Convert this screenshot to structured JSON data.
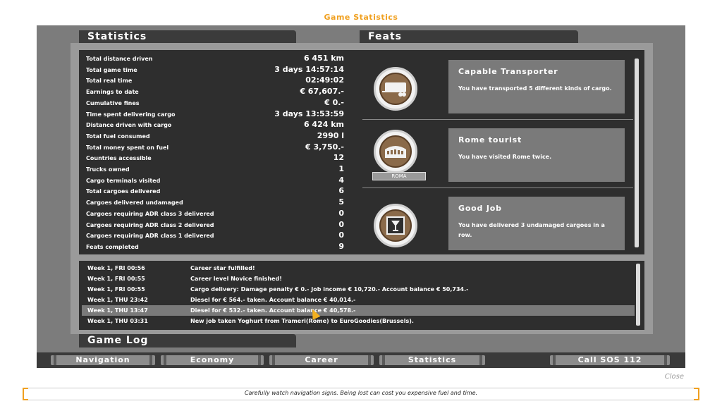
{
  "window_title": "Game Statistics",
  "tabs": {
    "statistics": "Statistics",
    "feats": "Feats",
    "game_log": "Game Log"
  },
  "stats": [
    {
      "label": "Total distance driven",
      "value": "6 451 km"
    },
    {
      "label": "Total game time",
      "value": "3 days 14:57:14"
    },
    {
      "label": "Total real time",
      "value": "02:49:02"
    },
    {
      "label": "Earnings to date",
      "value": "€ 67,607.-"
    },
    {
      "label": "Cumulative fines",
      "value": "€ 0.-"
    },
    {
      "label": "Time spent delivering cargo",
      "value": "3 days 13:53:59"
    },
    {
      "label": "Distance driven with cargo",
      "value": "6 424 km"
    },
    {
      "label": "Total fuel consumed",
      "value": "2990 l"
    },
    {
      "label": "Total money spent on fuel",
      "value": "€ 3,750.-"
    },
    {
      "label": "Countries accessible",
      "value": "12"
    },
    {
      "label": "Trucks owned",
      "value": "1"
    },
    {
      "label": "Cargo terminals visited",
      "value": "4"
    },
    {
      "label": "Total cargoes delivered",
      "value": "6"
    },
    {
      "label": "Cargoes delivered undamaged",
      "value": "5"
    },
    {
      "label": "Cargoes requiring ADR class 3 delivered",
      "value": "0"
    },
    {
      "label": "Cargoes requiring ADR class 2 delivered",
      "value": "0"
    },
    {
      "label": "Cargoes requiring ADR class 1 delivered",
      "value": "0"
    },
    {
      "label": "Feats completed",
      "value": "9"
    }
  ],
  "feats": [
    {
      "title": "Capable Transporter",
      "desc": "You have transported 5 different kinds of cargo.",
      "icon": "trailer-icon"
    },
    {
      "title": "Rome tourist",
      "desc": "You have visited Rome twice.",
      "icon": "colosseum-icon",
      "badge": "ROMA"
    },
    {
      "title": "Good Job",
      "desc": "You have delivered 3 undamaged cargoes in a row.",
      "icon": "glass-icon"
    }
  ],
  "log": [
    {
      "time": "Week 1, FRI 00:56",
      "msg": "Career star fulfilled!"
    },
    {
      "time": "Week 1, FRI 00:55",
      "msg": "Career level Novice finished!"
    },
    {
      "time": "Week 1, FRI 00:55",
      "msg": "Cargo delivery: Damage penalty € 0.- Job income € 10,720.- Account balance € 50,734.-"
    },
    {
      "time": "Week 1, THU 23:42",
      "msg": "Diesel for € 564.- taken. Account balance € 40,014.-"
    },
    {
      "time": "Week 1, THU 13:47",
      "msg": "Diesel for € 532.- taken. Account balance € 40,578.-"
    },
    {
      "time": "Week 1, THU 03:31",
      "msg": "New job taken Yoghurt from Trameri(Rome) to EuroGoodies(Brussels)."
    }
  ],
  "nav": {
    "navigation": "Navigation",
    "economy": "Economy",
    "career": "Career",
    "statistics": "Statistics",
    "sos": "Call SOS 112"
  },
  "close_label": "Close",
  "tip": "Carefully watch navigation signs. Being lost can cost you expensive fuel and time.",
  "colors": {
    "accent": "#f0a020",
    "panel": "#2e2e2e",
    "frame": "#7c7c7c"
  }
}
